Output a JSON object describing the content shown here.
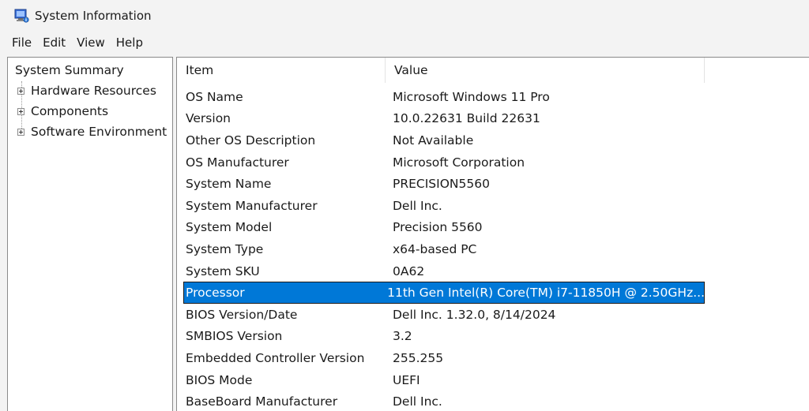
{
  "window": {
    "title": "System Information",
    "icon": "system-information-icon"
  },
  "menu": [
    "File",
    "Edit",
    "View",
    "Help"
  ],
  "tree": {
    "root": "System Summary",
    "children": [
      "Hardware Resources",
      "Components",
      "Software Environment"
    ]
  },
  "list": {
    "columns": {
      "item": "Item",
      "value": "Value"
    },
    "selected_index": 9,
    "rows": [
      {
        "item": "OS Name",
        "value": "Microsoft Windows 11 Pro"
      },
      {
        "item": "Version",
        "value": "10.0.22631 Build 22631"
      },
      {
        "item": "Other OS Description",
        "value": "Not Available"
      },
      {
        "item": "OS Manufacturer",
        "value": "Microsoft Corporation"
      },
      {
        "item": "System Name",
        "value": "PRECISION5560"
      },
      {
        "item": "System Manufacturer",
        "value": "Dell Inc."
      },
      {
        "item": "System Model",
        "value": "Precision 5560"
      },
      {
        "item": "System Type",
        "value": "x64-based PC"
      },
      {
        "item": "System SKU",
        "value": "0A62"
      },
      {
        "item": "Processor",
        "value": "11th Gen Intel(R) Core(TM) i7-11850H @ 2.50GHz..."
      },
      {
        "item": "BIOS Version/Date",
        "value": "Dell Inc. 1.32.0, 8/14/2024"
      },
      {
        "item": "SMBIOS Version",
        "value": "3.2"
      },
      {
        "item": "Embedded Controller Version",
        "value": "255.255"
      },
      {
        "item": "BIOS Mode",
        "value": "UEFI"
      },
      {
        "item": "BaseBoard Manufacturer",
        "value": "Dell Inc."
      }
    ]
  },
  "colors": {
    "selection": "#0078d7",
    "window_bg": "#f3f3f3",
    "pane_bg": "#ffffff"
  }
}
